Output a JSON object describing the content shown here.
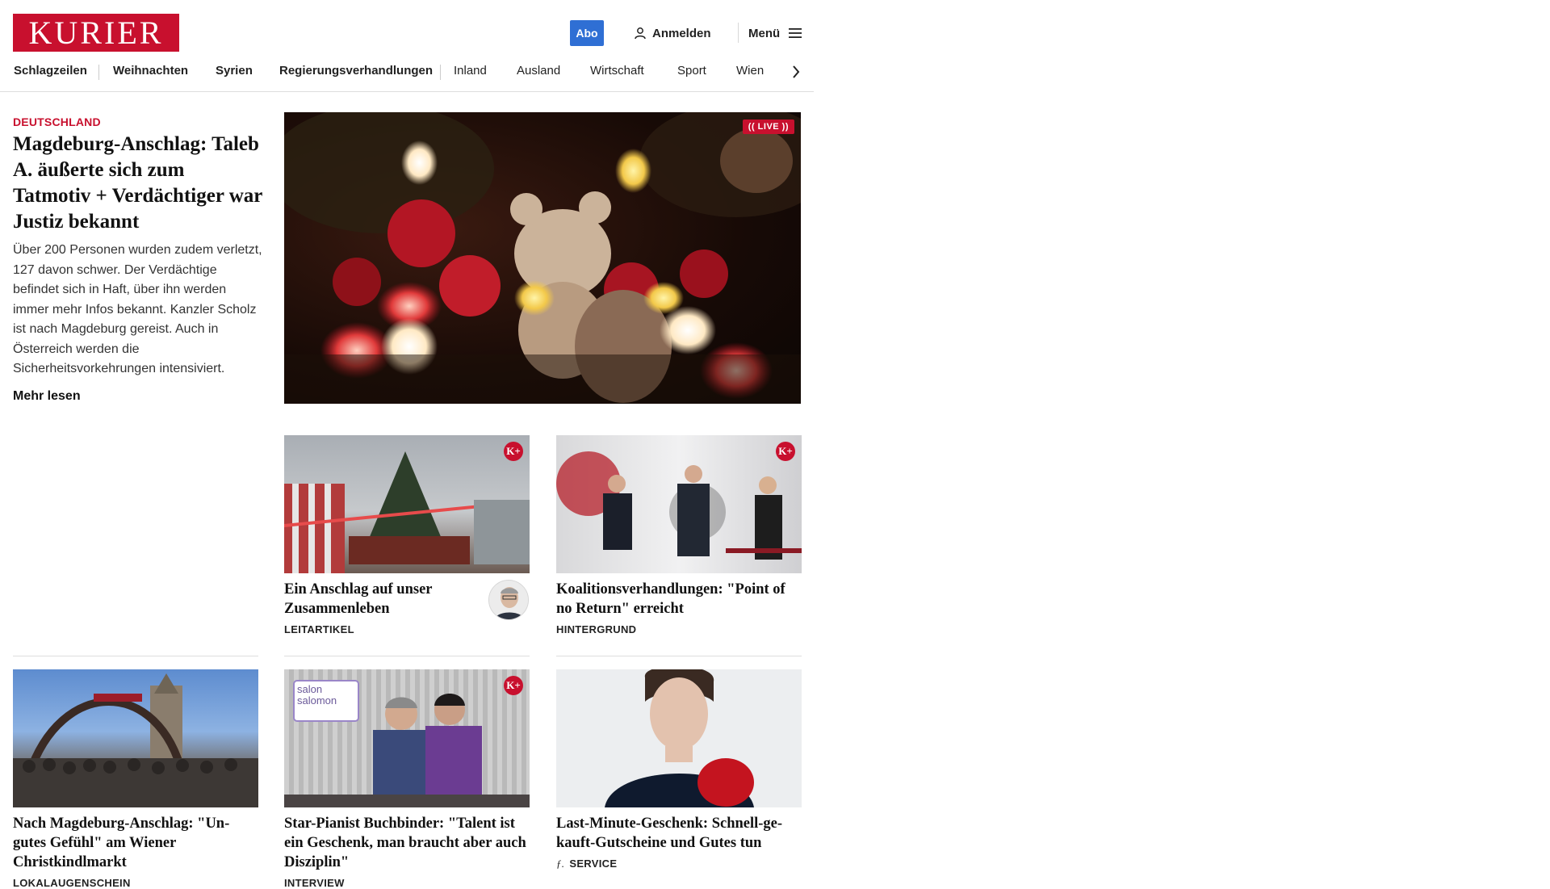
{
  "header": {
    "logo_text": "KURIER",
    "abo_label": "Abo",
    "login_label": "Anmelden",
    "menu_label": "Menü"
  },
  "nav": {
    "primary": [
      "Schlagzeilen",
      "Weihnachten",
      "Syrien",
      "Regierungsverhandlungen"
    ],
    "secondary": [
      "Inland",
      "Ausland",
      "Wirtschaft",
      "Sport",
      "Wien"
    ]
  },
  "lead": {
    "kicker": "DEUTSCHLAND",
    "title": "Magdeburg-Anschlag: Taleb A. äußerte sich zum Tatmotiv + Verdächtiger war Justiz bekannt",
    "teaser": "Über 200 Personen wurden zudem verletzt, 127 davon schwer. Der Verdächtige befindet sich in Haft, über ihn werden immer mehr Infos bekannt. Kanzler Scholz ist nach Magdeburg gereist. Auch in Österreich werden die Sicherheitsvorkehrungen intensiviert.",
    "more_label": "Mehr lesen",
    "live_label": "(( LIVE ))"
  },
  "cards": [
    {
      "title": "Ein Anschlag auf unser Zusammenleben",
      "kicker": "LEITARTIKEL",
      "badge": "K+"
    },
    {
      "title": "Koalitionsverhandlungen: \"Point of no Return\" erreicht",
      "kicker": "HINTERGRUND",
      "badge": "K+"
    },
    {
      "title": "Nach Magdeburg-Anschlag: \"Un-gutes Gefühl\" am Wiener Christkindlmarkt",
      "kicker": "LOKALAUGENSCHEIN"
    },
    {
      "title": "Star-Pianist Buchbinder: \"Talent ist ein Geschenk, man braucht aber auch Disziplin\"",
      "kicker": "INTERVIEW",
      "badge": "K+",
      "image_label": "salon salomon"
    },
    {
      "title": "Last-Minute-Geschenk: Schnell-ge-kauft-Gutscheine und Gutes tun",
      "kicker": "SERVICE",
      "kicker_icon": "ƒ."
    }
  ]
}
